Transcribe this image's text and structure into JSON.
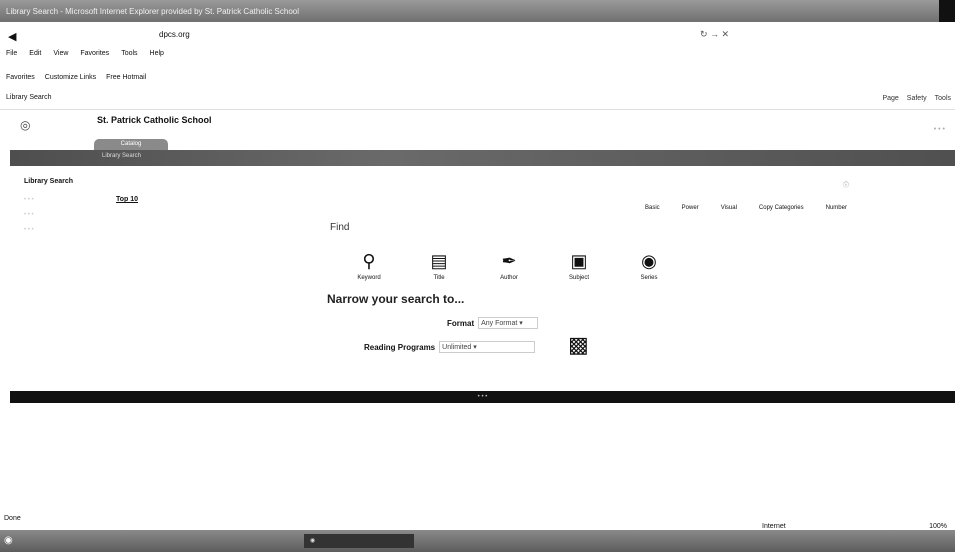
{
  "window": {
    "title": "Library Search - Microsoft Internet Explorer provided by St. Patrick Catholic School"
  },
  "address": {
    "url": "dpcs.org",
    "back_icon": "back-arrow-icon"
  },
  "menu": {
    "items": [
      "File",
      "Edit",
      "View",
      "Favorites",
      "Tools",
      "Help"
    ]
  },
  "favorites_bar": {
    "favorites": "Favorites",
    "customize": "Customize Links",
    "hotmail": "Free Hotmail"
  },
  "tab": {
    "label": "Library Search"
  },
  "commandbar": {
    "page": "Page",
    "safety": "Safety",
    "tools": "Tools"
  },
  "site": {
    "school_name": "St. Patrick Catholic School",
    "catalog_tab": "Catalog",
    "sub_tab": "Library Search"
  },
  "sidebar": {
    "title": "Library Search"
  },
  "main": {
    "top10": "Top 10",
    "modes": [
      "Basic",
      "Power",
      "Visual",
      "Copy Categories",
      "Number"
    ],
    "find": "Find",
    "search_types": [
      {
        "label": "Keyword",
        "icon": "key-icon"
      },
      {
        "label": "Title",
        "icon": "book-icon"
      },
      {
        "label": "Author",
        "icon": "pen-icon"
      },
      {
        "label": "Subject",
        "icon": "subject-icon"
      },
      {
        "label": "Series",
        "icon": "series-icon"
      }
    ],
    "narrow": "Narrow your search to...",
    "format_label": "Format",
    "format_value": "Any Format",
    "reading_label": "Reading Programs",
    "reading_value": "Unlimited"
  },
  "status": {
    "text": "Done",
    "zone": "Internet",
    "zoom": "100%"
  }
}
